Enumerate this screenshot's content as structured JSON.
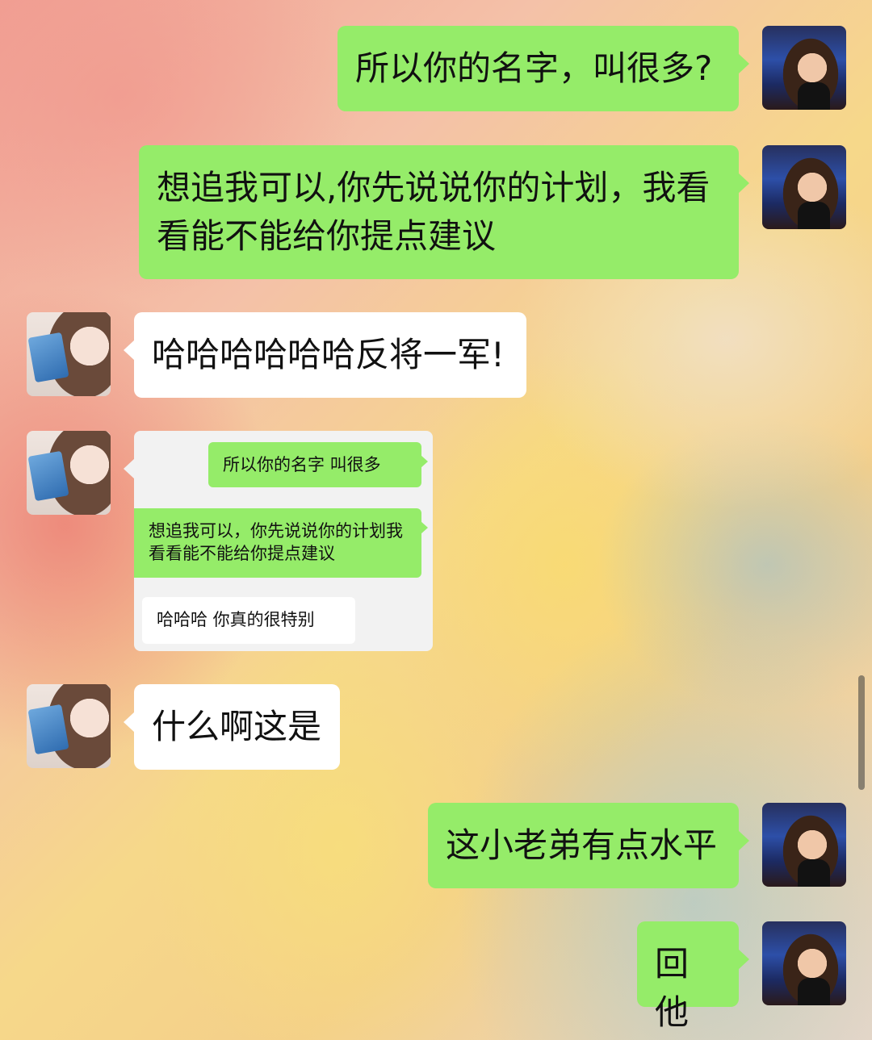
{
  "messages": [
    {
      "sender": "me",
      "text": "所以你的名字，叫很多?"
    },
    {
      "sender": "me",
      "text": "想追我可以,你先说说你的计划，我看看能不能给你提点建议"
    },
    {
      "sender": "her",
      "text": "哈哈哈哈哈哈反将一军!"
    },
    {
      "sender": "her",
      "type": "screenshot",
      "quoted": [
        {
          "side": "right",
          "text": "所以你的名字 叫很多"
        },
        {
          "side": "right",
          "text": "想追我可以，你先说说你的计划我看看能不能给你提点建议"
        },
        {
          "side": "left",
          "text": "哈哈哈 你真的很特别"
        }
      ]
    },
    {
      "sender": "her",
      "text": "什么啊这是"
    },
    {
      "sender": "me",
      "text": "这小老弟有点水平"
    },
    {
      "sender": "me",
      "text": "回他"
    }
  ],
  "colors": {
    "sent_bubble": "#95ec69",
    "received_bubble": "#ffffff",
    "quote_card": "#f2f2f2"
  },
  "icons": {
    "me_avatar": "avatar-woman-night-city",
    "her_avatar": "avatar-girl-holding-book"
  }
}
